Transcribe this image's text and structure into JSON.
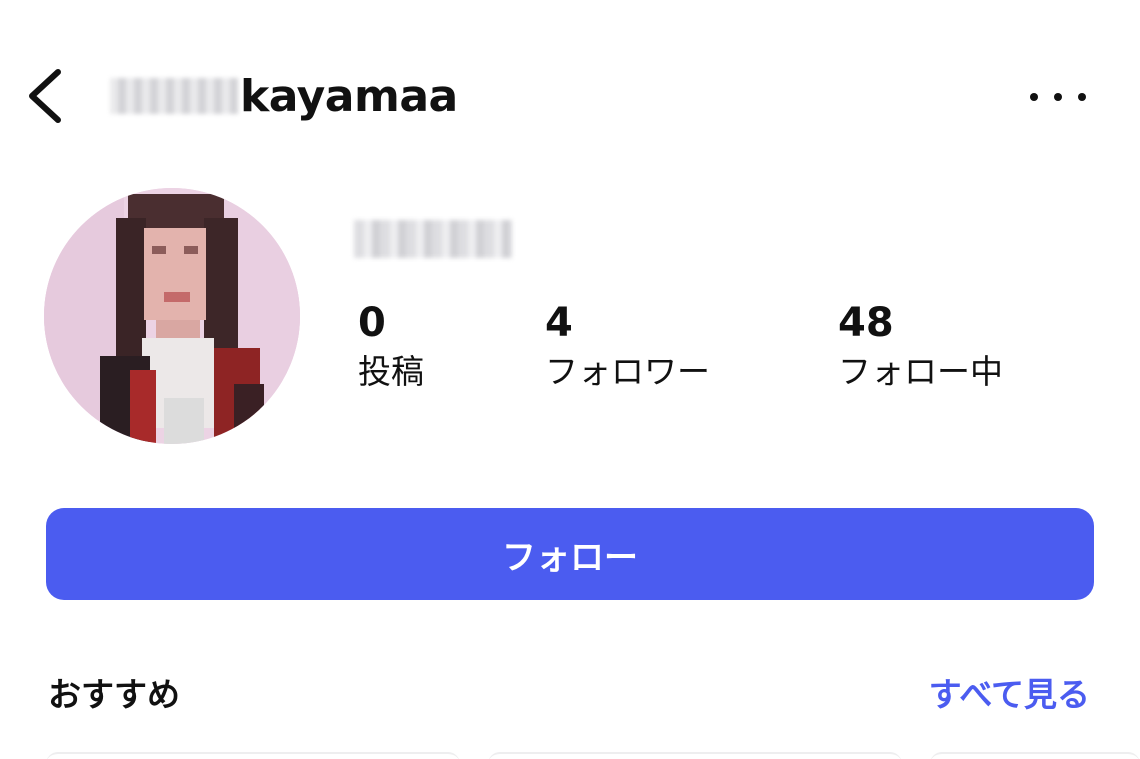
{
  "header": {
    "username_visible": "kayamaa",
    "back_icon": "chevron-left-icon",
    "more_icon": "more-horizontal-icon"
  },
  "profile": {
    "stats": [
      {
        "value": "0",
        "label": "投稿"
      },
      {
        "value": "4",
        "label": "フォロワー"
      },
      {
        "value": "48",
        "label": "フォロー中"
      }
    ]
  },
  "actions": {
    "follow_label": "フォロー"
  },
  "suggested": {
    "title": "おすすめ",
    "see_all_label": "すべて見る"
  },
  "colors": {
    "accent": "#4b5cf0",
    "text": "#111111",
    "background": "#ffffff"
  }
}
